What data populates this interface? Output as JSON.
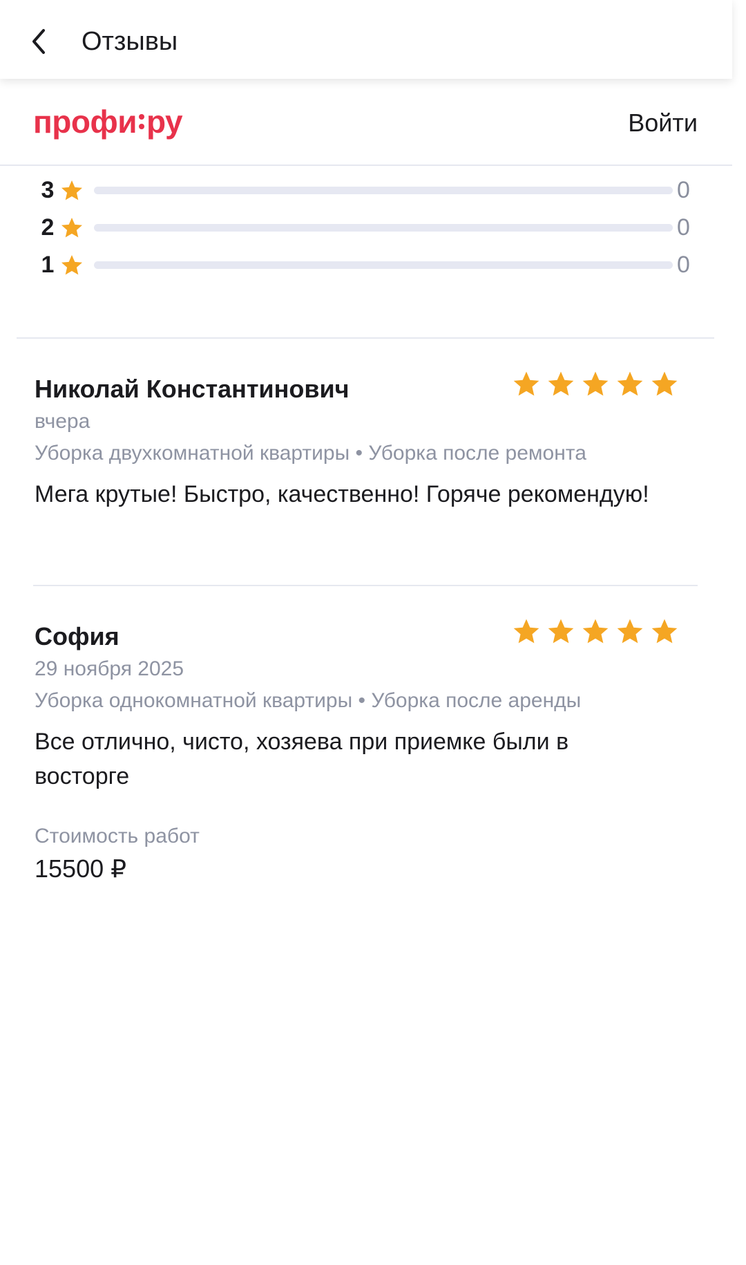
{
  "header": {
    "title": "Отзывы",
    "back_icon": "chevron-left-icon"
  },
  "site": {
    "logo_left": "профи",
    "logo_right": "ру",
    "login_label": "Войти",
    "brand_color": "#e8324b"
  },
  "rating_breakdown": [
    {
      "stars": "3",
      "count": "0",
      "fraction": 0
    },
    {
      "stars": "2",
      "count": "0",
      "fraction": 0
    },
    {
      "stars": "1",
      "count": "0",
      "fraction": 0
    }
  ],
  "reviews": [
    {
      "name": "Николай Константинович",
      "date": "вчера",
      "tags": "Уборка двухкомнатной квартиры • Уборка после ремонта",
      "text": "Мега крутые! Быстро, качественно! Горяче рекомендую!",
      "rating": 5
    },
    {
      "name": "София",
      "date": "29 ноября 2025",
      "tags": "Уборка однокомнатной квартиры • Уборка после аренды",
      "text": "Все отлично, чисто, хозяева при приемке были в восторге",
      "rating": 5,
      "cost_label": "Стоимость работ",
      "cost_value": "15500 ₽"
    }
  ],
  "colors": {
    "star": "#f5a623",
    "muted_text": "#8e93a2",
    "divider": "#e6e8f0"
  }
}
